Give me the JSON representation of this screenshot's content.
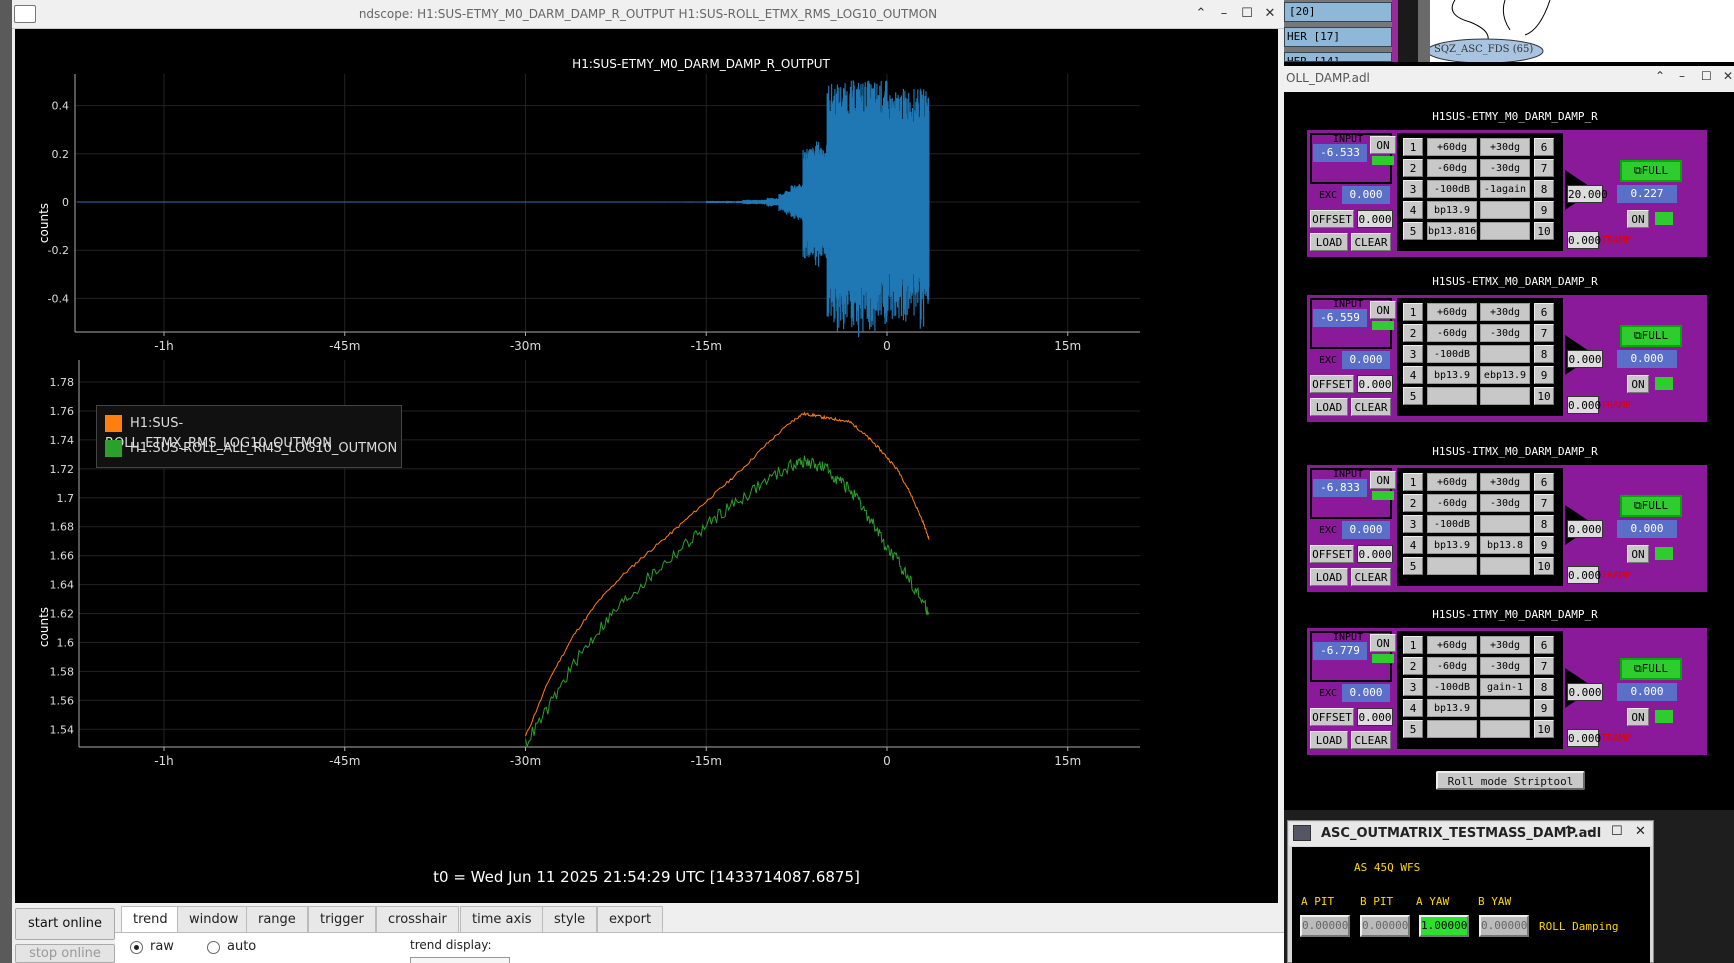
{
  "window": {
    "title": "ndscope: H1:SUS-ETMY_M0_DARM_DAMP_R_OUTPUT H1:SUS-ROLL_ETMX_RMS_LOG10_OUTMON"
  },
  "plot1": {
    "title": "H1:SUS-ETMY_M0_DARM_DAMP_R_OUTPUT",
    "ylabel": "counts",
    "yticks": [
      "0.4",
      "0.2",
      "0",
      "-0.2",
      "-0.4"
    ],
    "xticks": [
      "-1h",
      "-45m",
      "-30m",
      "-15m",
      "0",
      "15m"
    ]
  },
  "plot2": {
    "ylabel": "counts",
    "yticks": [
      "1.78",
      "1.76",
      "1.74",
      "1.72",
      "1.7",
      "1.68",
      "1.66",
      "1.64",
      "1.62",
      "1.6",
      "1.58",
      "1.56",
      "1.54"
    ],
    "xticks": [
      "-1h",
      "-45m",
      "-30m",
      "-15m",
      "0",
      "15m"
    ],
    "legend": [
      {
        "name": "H1:SUS-ROLL_ETMX_RMS_LOG10_OUTMON",
        "color": "#ff7f0e"
      },
      {
        "name": "H1:SUS-ROLL_ALL_RMS_LOG10_OUTMON",
        "color": "#2ca02c"
      }
    ]
  },
  "chart_data": [
    {
      "type": "line",
      "title": "H1:SUS-ETMY_M0_DARM_DAMP_R_OUTPUT",
      "ylabel": "counts",
      "x_unit": "minutes relative to t0",
      "xlim": [
        -65,
        20
      ],
      "ylim": [
        -0.5,
        0.5
      ],
      "series": [
        {
          "name": "H1:SUS-ETMY_M0_DARM_DAMP_R_OUTPUT",
          "color": "#1f77b4",
          "envelope_x": [
            -20,
            -15,
            -12,
            -10,
            -9,
            -8.5,
            -8,
            -7,
            -6,
            -5.5,
            -5,
            -3,
            0,
            1,
            3.5
          ],
          "envelope_amp": [
            0.002,
            0.004,
            0.008,
            0.015,
            0.03,
            0.04,
            0.065,
            0.2,
            0.22,
            0.21,
            0.43,
            0.44,
            0.4,
            0.41,
            0.38
          ]
        }
      ]
    },
    {
      "type": "line",
      "ylabel": "counts",
      "xlim": [
        -65,
        20
      ],
      "ylim": [
        1.53,
        1.79
      ],
      "series": [
        {
          "name": "H1:SUS-ROLL_ETMX_RMS_LOG10_OUTMON",
          "color": "#ff7f0e",
          "x": [
            -30,
            -28,
            -26,
            -24,
            -22,
            -20,
            -18,
            -16,
            -14,
            -12,
            -10,
            -8,
            -7,
            -6,
            -5,
            -4,
            -3,
            -2,
            -1,
            0,
            1,
            2,
            3,
            3.5
          ],
          "y": [
            1.535,
            1.575,
            1.605,
            1.628,
            1.646,
            1.661,
            1.675,
            1.69,
            1.705,
            1.72,
            1.737,
            1.752,
            1.758,
            1.757,
            1.755,
            1.754,
            1.752,
            1.745,
            1.737,
            1.728,
            1.718,
            1.702,
            1.683,
            1.671
          ]
        },
        {
          "name": "H1:SUS-ROLL_ALL_RMS_LOG10_OUTMON",
          "color": "#2ca02c",
          "x": [
            -30,
            -28,
            -26,
            -24,
            -22,
            -20,
            -18,
            -16,
            -14,
            -12,
            -10,
            -8,
            -7,
            -6,
            -5,
            -4,
            -3,
            -2,
            -1,
            0,
            1,
            2,
            3,
            3.5
          ],
          "y": [
            1.53,
            1.556,
            1.585,
            1.608,
            1.627,
            1.643,
            1.658,
            1.673,
            1.688,
            1.7,
            1.712,
            1.722,
            1.725,
            1.723,
            1.72,
            1.712,
            1.705,
            1.692,
            1.68,
            1.665,
            1.655,
            1.642,
            1.628,
            1.62
          ]
        }
      ]
    }
  ],
  "t0": "t0 = Wed Jun 11 2025 21:54:29 UTC [1433714087.6875]",
  "controls": {
    "start_online": "start online",
    "stop_online": "stop online",
    "tabs": [
      "trend",
      "window",
      "range",
      "trigger",
      "crosshair",
      "time axis",
      "style",
      "export"
    ],
    "raw": "raw",
    "auto": "auto",
    "trend_display": "trend display:"
  },
  "medm": {
    "top_items": [
      "[20]",
      "HER  [17]",
      "HER  [14]"
    ],
    "top_node": "SQZ_ASC_FDS (65)",
    "title": "OLL_DAMP.adl",
    "banks": [
      {
        "name": "H1SUS-ETMY_M0_DARM_DAMP_R",
        "input": "-6.533",
        "exc": "0.000",
        "offset": "0.000",
        "gain": "20.000",
        "tramp": "0.000",
        "out": "0.227",
        "filters": [
          "+60dg",
          "-60dg",
          "-100dB",
          "bp13.9",
          "bp13.816"
        ],
        "filters2": [
          "+30dg",
          "-30dg",
          "-1again",
          "",
          ""
        ]
      },
      {
        "name": "H1SUS-ETMX_M0_DARM_DAMP_R",
        "input": "-6.559",
        "exc": "0.000",
        "offset": "0.000",
        "gain": "0.000",
        "tramp": "0.000",
        "out": "0.000",
        "filters": [
          "+60dg",
          "-60dg",
          "-100dB",
          "bp13.9",
          ""
        ],
        "filters2": [
          "+30dg",
          "-30dg",
          "",
          "ebp13.9",
          ""
        ]
      },
      {
        "name": "H1SUS-ITMX_M0_DARM_DAMP_R",
        "input": "-6.833",
        "exc": "0.000",
        "offset": "0.000",
        "gain": "0.000",
        "tramp": "0.000",
        "out": "0.000",
        "filters": [
          "+60dg",
          "-60dg",
          "-100dB",
          "bp13.9",
          ""
        ],
        "filters2": [
          "+30dg",
          "-30dg",
          "",
          "bp13.8",
          ""
        ]
      },
      {
        "name": "H1SUS-ITMY_M0_DARM_DAMP_R",
        "input": "-6.779",
        "exc": "0.000",
        "offset": "0.000",
        "gain": "0.000",
        "tramp": "0.000",
        "out": "0.000",
        "filters": [
          "+60dg",
          "-60dg",
          "-100dB",
          "bp13.9",
          ""
        ],
        "filters2": [
          "+30dg",
          "-30dg",
          "gain-1",
          "",
          ""
        ]
      }
    ],
    "labels": {
      "input": "INPUT",
      "on": "ON",
      "exc": "EXC",
      "offset": "OFFSET",
      "load": "LOAD",
      "clear": "CLEAR",
      "full": "FULL",
      "tramp": "TRAMP"
    },
    "striptool": "Roll mode Striptool"
  },
  "asc": {
    "title": "ASC_OUTMATRIX_TESTMASS_DAMP.adl",
    "subtitle": "AS 45Q WFS",
    "cols": [
      "A PIT",
      "B PIT",
      "A YAW",
      "B YAW"
    ],
    "values": [
      "0.00000",
      "0.00000",
      "1.00000",
      "0.00000"
    ],
    "row_label": "ROLL Damping"
  }
}
